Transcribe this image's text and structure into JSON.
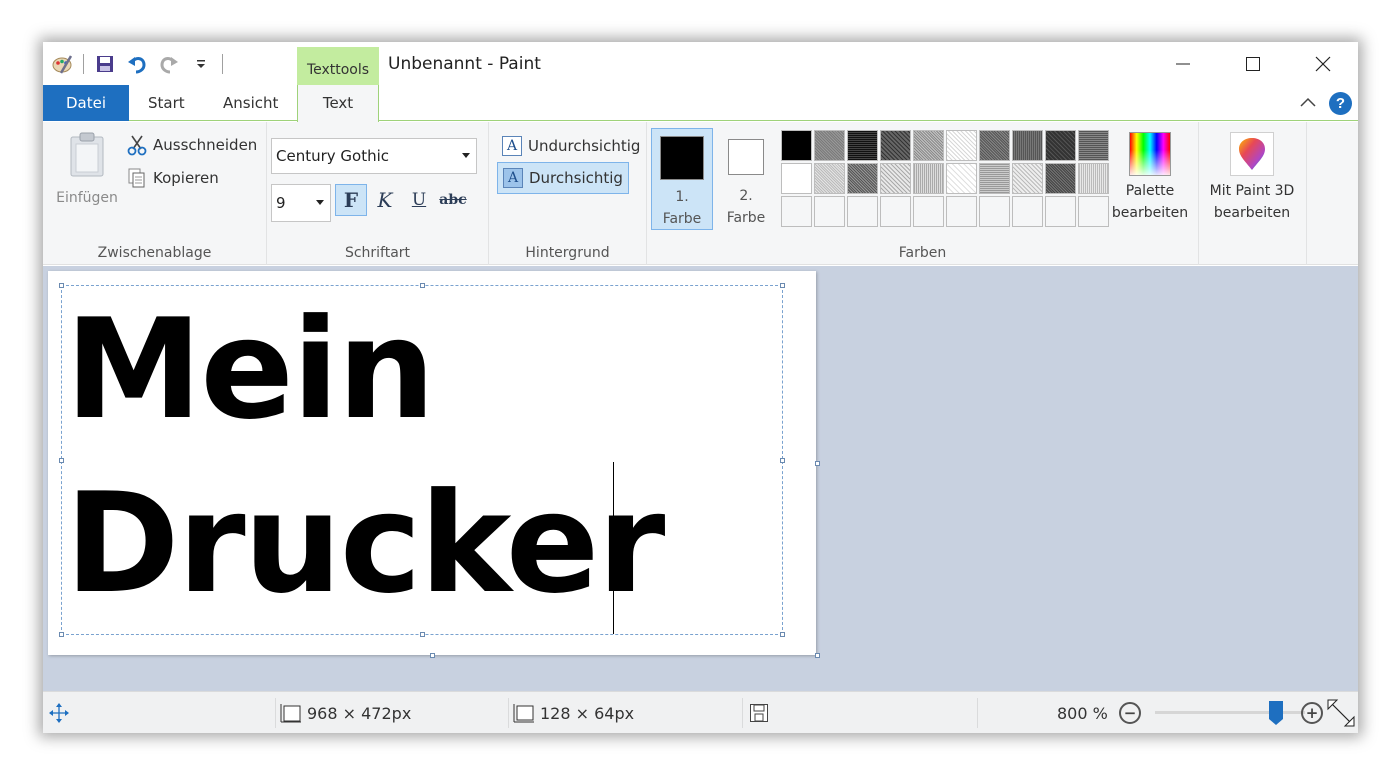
{
  "window": {
    "title": "Unbenannt - Paint",
    "contextual_tab": "Texttools"
  },
  "tabs": {
    "file": "Datei",
    "start": "Start",
    "view": "Ansicht",
    "text": "Text"
  },
  "help_label": "?",
  "clipboard": {
    "paste": "Einfügen",
    "cut": "Ausschneiden",
    "copy": "Kopieren",
    "group_label": "Zwischenablage"
  },
  "font": {
    "family": "Century Gothic",
    "size": "9",
    "bold": "F",
    "italic": "K",
    "underline": "U",
    "strikethrough": "abc",
    "group_label": "Schriftart"
  },
  "background": {
    "opaque": "Undurchsichtig",
    "transparent": "Durchsichtig",
    "group_label": "Hintergrund",
    "selected": "Durchsichtig"
  },
  "colors": {
    "color1_line1": "1.",
    "color1_line2": "Farbe",
    "color1_value": "#000000",
    "color2_line1": "2.",
    "color2_line2": "Farbe",
    "color2_value": "#ffffff",
    "edit_palette_line1": "Palette",
    "edit_palette_line2": "bearbeiten",
    "group_label": "Farben"
  },
  "paint3d": {
    "line1": "Mit Paint 3D",
    "line2": "bearbeiten"
  },
  "canvas": {
    "line1": "Mein",
    "line2": "Drucker"
  },
  "status": {
    "canvas_size": "968 × 472px",
    "selection_size": "128 × 64px",
    "zoom": "800 %",
    "zoom_out": "−",
    "zoom_in": "+"
  }
}
